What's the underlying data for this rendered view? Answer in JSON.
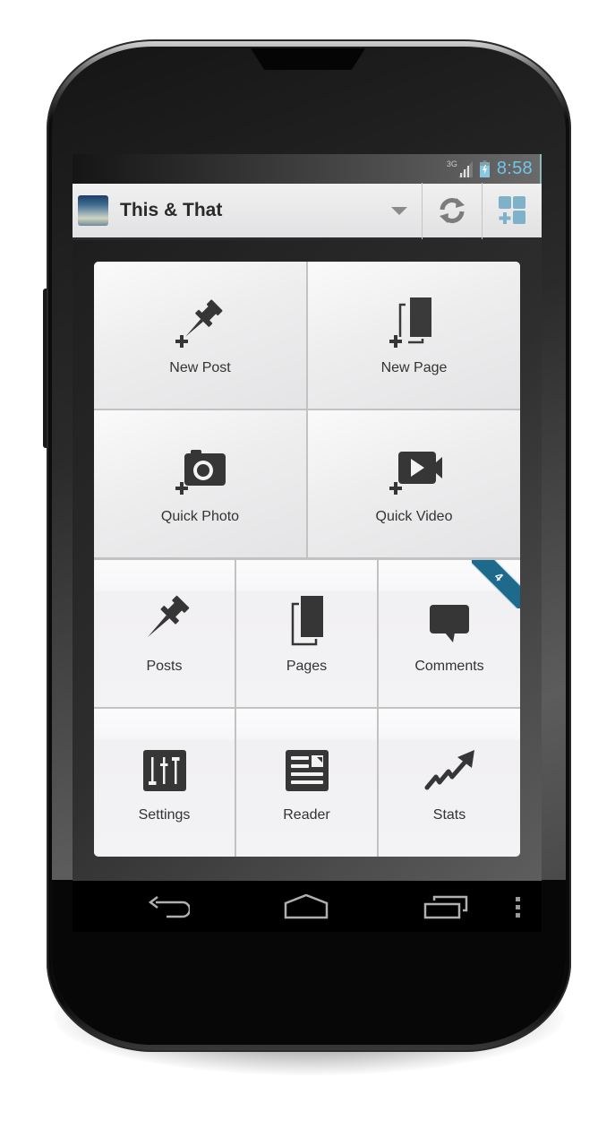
{
  "status_bar": {
    "network": "3G",
    "signal_icon": "signal-icon",
    "battery_icon": "battery-charging-icon",
    "time": "8:58",
    "clock_color": "#6fc6e6"
  },
  "action_bar": {
    "site_title": "This & That",
    "site_avatar": "site-avatar-image",
    "dropdown_icon": "dropdown-caret-icon",
    "refresh_icon": "refresh-icon",
    "add_site_icon": "add-dashboard-icon",
    "accent_color": "#7fb2c9"
  },
  "dashboard": {
    "primary_tiles": [
      {
        "label": "New Post",
        "icon": "new-post-pushpin-icon"
      },
      {
        "label": "New Page",
        "icon": "new-page-icon"
      },
      {
        "label": "Quick Photo",
        "icon": "quick-photo-camera-icon"
      },
      {
        "label": "Quick Video",
        "icon": "quick-video-icon"
      }
    ],
    "secondary_tiles": [
      {
        "label": "Posts",
        "icon": "pushpin-icon"
      },
      {
        "label": "Pages",
        "icon": "pages-icon"
      },
      {
        "label": "Comments",
        "icon": "comment-bubble-icon",
        "badge": "4"
      },
      {
        "label": "Settings",
        "icon": "settings-sliders-icon"
      },
      {
        "label": "Reader",
        "icon": "reader-newspaper-icon"
      },
      {
        "label": "Stats",
        "icon": "stats-trend-icon"
      }
    ],
    "badge_color": "#1e6a8c"
  },
  "nav_bar": {
    "back_icon": "back-icon",
    "home_icon": "home-icon",
    "recents_icon": "recent-apps-icon",
    "menu_icon": "overflow-menu-icon"
  }
}
